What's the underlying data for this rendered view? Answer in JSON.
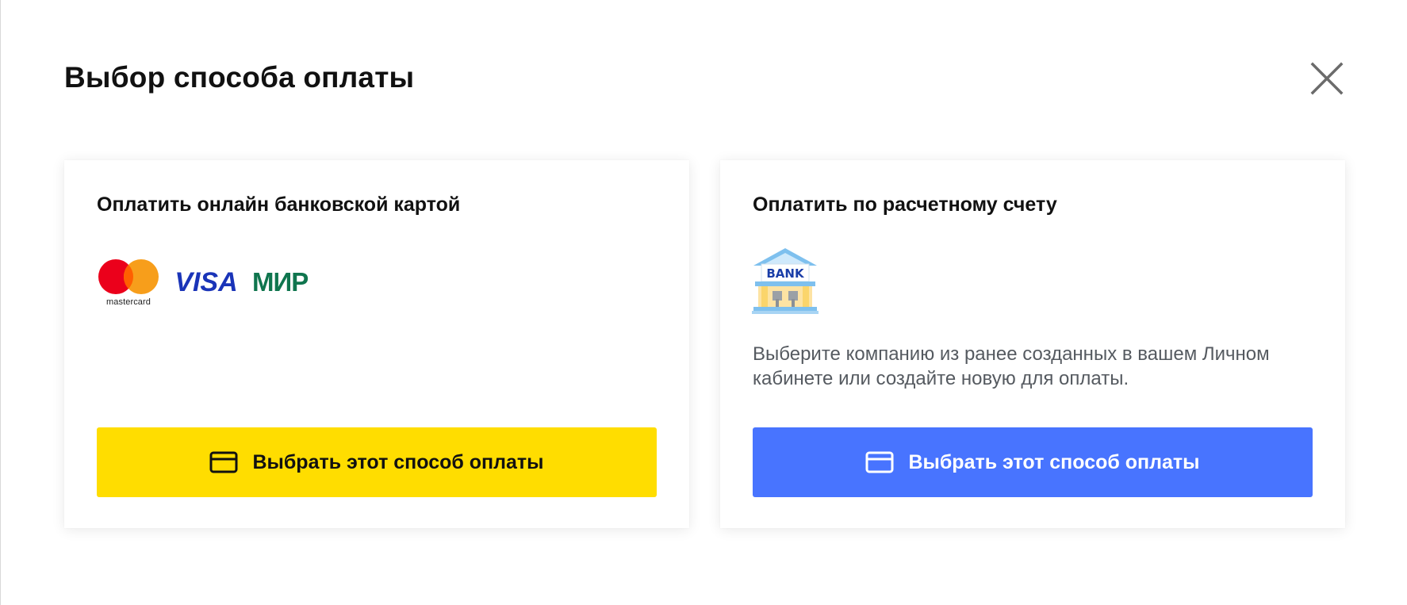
{
  "modal": {
    "title": "Выбор способа оплаты"
  },
  "card_option": {
    "title": "Оплатить онлайн банковской картой",
    "logos": {
      "mastercard": "mastercard",
      "visa": "VISA",
      "mir": "МИР"
    },
    "button_label": "Выбрать этот способ оплаты",
    "button_color": "#ffdd00",
    "button_icon": "credit-card-icon"
  },
  "bank_option": {
    "title": "Оплатить по расчетному счету",
    "icon_text": "BANK",
    "icon": "bank-building-icon",
    "description": "Выберите компанию из ранее созданных в вашем Личном кабинете или создайте новую для оплаты.",
    "button_label": "Выбрать этот способ оплаты",
    "button_color": "#4874ff",
    "button_icon": "credit-card-icon"
  }
}
